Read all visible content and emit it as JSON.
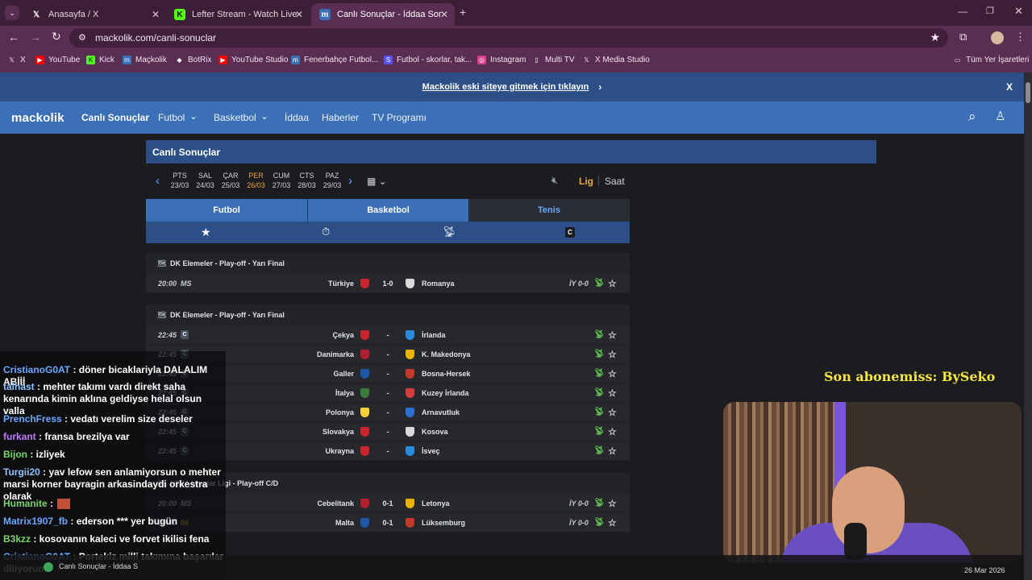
{
  "tabs": [
    {
      "label": "Anasayfa / X",
      "icon": "x-logo-icon"
    },
    {
      "label": "Lefter Stream - Watch Live on K",
      "icon": "kick-logo-icon"
    },
    {
      "label": "Canlı Sonuçlar - İddaa Sonuçla",
      "icon": "mackolik-logo-icon"
    }
  ],
  "url": "mackolik.com/canli-sonuclar",
  "bookmarks": [
    "X",
    "YouTube",
    "Kick",
    "Maçkolik",
    "BotRix",
    "YouTube Studio",
    "Fenerbahçe Futbol...",
    "Futbol - skorlar, tak...",
    "Instagram",
    "Multi TV",
    "X Media Studio",
    "Tüm Yer İşaretleri"
  ],
  "notice": "Mackolik eski siteye gitmek için tıklayın",
  "notice_close": "X",
  "nav": {
    "logo": "mackolik",
    "items": [
      "Canlı Sonuçlar",
      "Futbol",
      "Basketbol",
      "İddaa",
      "Haberler",
      "TV Programı"
    ]
  },
  "section_title": "Canlı Sonuçlar",
  "days": [
    {
      "name": "PTS",
      "date": "23/03"
    },
    {
      "name": "SAL",
      "date": "24/03"
    },
    {
      "name": "ÇAR",
      "date": "25/03"
    },
    {
      "name": "PER",
      "date": "26/03"
    },
    {
      "name": "CUM",
      "date": "27/03"
    },
    {
      "name": "CTS",
      "date": "28/03"
    },
    {
      "name": "PAZ",
      "date": "29/03"
    }
  ],
  "sort": {
    "league": "Lig",
    "time": "Saat"
  },
  "sports": [
    "Futbol",
    "Basketbol",
    "Tenis"
  ],
  "filter_letter": "C",
  "leagues": [
    {
      "name": "DK Elemeler - Play-off - Yarı Final",
      "matches": [
        {
          "time": "20:00",
          "status": "MS",
          "home": "Türkiye",
          "score": "1-0",
          "away": "Romanya",
          "ht": "İY 0-0"
        }
      ]
    },
    {
      "name": "DK Elemeler - Play-off - Yarı Final",
      "matches": [
        {
          "time": "22:45",
          "status": "C",
          "home": "Çekya",
          "score": "-",
          "away": "İrlanda",
          "ht": ""
        },
        {
          "time": "22:45",
          "status": "C",
          "home": "Danimarka",
          "score": "-",
          "away": "K. Makedonya",
          "ht": ""
        },
        {
          "time": "22:45",
          "status": "C",
          "home": "Galler",
          "score": "-",
          "away": "Bosna-Hersek",
          "ht": ""
        },
        {
          "time": "22:45",
          "status": "C",
          "home": "İtalya",
          "score": "-",
          "away": "Kuzey İrlanda",
          "ht": ""
        },
        {
          "time": "22:45",
          "status": "C",
          "home": "Polonya",
          "score": "-",
          "away": "Arnavutluk",
          "ht": ""
        },
        {
          "time": "22:45",
          "status": "C",
          "home": "Slovakya",
          "score": "-",
          "away": "Kosova",
          "ht": ""
        },
        {
          "time": "22:45",
          "status": "C",
          "home": "Ukrayna",
          "score": "-",
          "away": "İsveç",
          "ht": ""
        }
      ]
    },
    {
      "name": "UEFA Uluslar Ligi - Play-off C/D",
      "matches": [
        {
          "time": "20:00",
          "status": "MS",
          "home": "Cebelitank",
          "score": "0-1",
          "away": "Letonya",
          "ht": "İY 0-0"
        },
        {
          "time": "20:00",
          "status": "86",
          "home": "Malta",
          "score": "0-1",
          "away": "Lüksemburg",
          "ht": "İY 0-0"
        }
      ]
    }
  ],
  "chat": [
    {
      "user": "CristianoG0AT",
      "text": " : döner bicaklariyla DALALIM ABİİİ",
      "color": "#6aa8ff"
    },
    {
      "user": "talhast",
      "text": " : mehter takımı vardı direkt saha kenarında kimin aklına geldiyse helal olsun valla",
      "color": "#8fc3ff"
    },
    {
      "user": "PrenchFress",
      "text": " : vedatı verelim size deseler",
      "color": "#6aa8ff"
    },
    {
      "user": "furkant",
      "text": " : fransa brezilya var",
      "color": "#c07cff"
    },
    {
      "user": "Bijon",
      "text": " : izliyek",
      "color": "#7bd66b"
    },
    {
      "user": "Turgii20",
      "text": " : yav lefow sen anlamiyorsun o mehter marsi korner bayragin arkasindaydi orkestra olarak",
      "color": "#8fc3ff"
    },
    {
      "user": "Humanite",
      "text": " :",
      "color": "#7bd66b"
    },
    {
      "user": "Matrix1907_fb",
      "text": " : ederson *** yer bugün",
      "color": "#6aa8ff"
    },
    {
      "user": "B3kzz",
      "text": " : kosovanın kaleci ve forvet ikilisi fena",
      "color": "#7bd66b"
    },
    {
      "user": "CristianoG0AT",
      "text": " : Portekiz milli takımına başarılar diliyorum",
      "color": "#6aa8ff"
    }
  ],
  "subscriber": "Son abonemiss: BySeko",
  "taskbar": {
    "app": "Canlı Sonuçlar - İddaa S",
    "date": "26 Mar 2026"
  },
  "colors": {
    "accent": "#3b6fb6",
    "dark_blue": "#2d4f87",
    "active_day": "#f0a33b",
    "tv_icon": "#68c45a"
  }
}
